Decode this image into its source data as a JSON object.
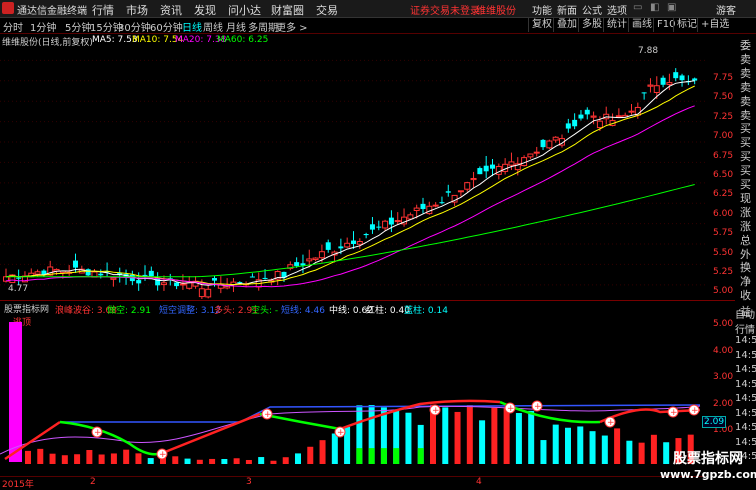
{
  "app": {
    "title": "通达信金融终端",
    "menus": [
      "行情",
      "市场",
      "资讯",
      "发现",
      "问小达",
      "财富圈",
      "交易"
    ],
    "notice": "证券交易未登录",
    "stock_link": "维维股份",
    "right_menus": [
      "功能",
      "新面",
      "公式",
      "选项"
    ],
    "user": "游客"
  },
  "toolbar": {
    "periods": [
      "分时",
      "1分钟",
      "5分钟",
      "15分钟",
      "30分钟",
      "60分钟",
      "日线",
      "周线",
      "月线",
      "多周期",
      "更多 >"
    ],
    "active_period": "日线",
    "right_buttons": [
      "复权",
      "叠加",
      "多股",
      "统计",
      "画线",
      "F10",
      "标记",
      "+自选"
    ]
  },
  "chart_info": {
    "name": "维维股份(日线,前复权)",
    "ma": [
      {
        "label": "MA5: 7.53",
        "color": "#ffffff"
      },
      {
        "label": "MA10: 7.54",
        "color": "#ffff00"
      },
      {
        "label": "MA20: 7.38",
        "color": "#ff00ff"
      },
      {
        "label": "MA60: 6.25",
        "color": "#00ff00"
      }
    ]
  },
  "price_axis": [
    "7.75",
    "7.50",
    "7.25",
    "7.00",
    "6.75",
    "6.50",
    "6.25",
    "6.00",
    "5.75",
    "5.50",
    "5.25",
    "5.00"
  ],
  "price_marks": {
    "high": "7.88",
    "low": "4.77"
  },
  "indicator": {
    "title": "股票指标网",
    "items": [
      {
        "label": "浪峰波谷: 3.08",
        "color": "#ff3333"
      },
      {
        "label": "做空: 2.91",
        "color": "#00ff00"
      },
      {
        "label": "短空调整: 3.12",
        "color": "#3366ff"
      },
      {
        "label": "多头: 2.91",
        "color": "#ff3333"
      },
      {
        "label": "空头: -",
        "color": "#00ff00"
      },
      {
        "label": "短线: 4.46",
        "color": "#3366ff"
      },
      {
        "label": "中线: 0.62",
        "color": "#ffffff"
      },
      {
        "label": "红柱: 0.40",
        "color": "#ffffff"
      },
      {
        "label": "蓝柱: 0.14",
        "color": "#00ffff"
      }
    ],
    "signal_label": "逃顶",
    "axis": [
      "5.00",
      "4.00",
      "3.00",
      "2.00",
      "1.00"
    ],
    "current_value": "2.09"
  },
  "side_panel": {
    "items": [
      "委比",
      "卖五",
      "卖四",
      "卖三",
      "卖二",
      "卖一",
      "买一",
      "买二",
      "买三",
      "买四",
      "买五",
      "现价",
      "涨跌",
      "涨幅",
      "总量",
      "外盘",
      "换手",
      "净资",
      "收益"
    ],
    "lower_items": [
      "自动",
      "行情",
      "14:5",
      "14:5",
      "14:5",
      "14:5",
      "14:5",
      "14:5",
      "14:5",
      "14:5",
      "14:5"
    ]
  },
  "dates": [
    "2015年",
    "2",
    "3",
    "4"
  ],
  "watermark": {
    "line1": "股票指标网",
    "line2": "www.7gpzb.com"
  }
}
